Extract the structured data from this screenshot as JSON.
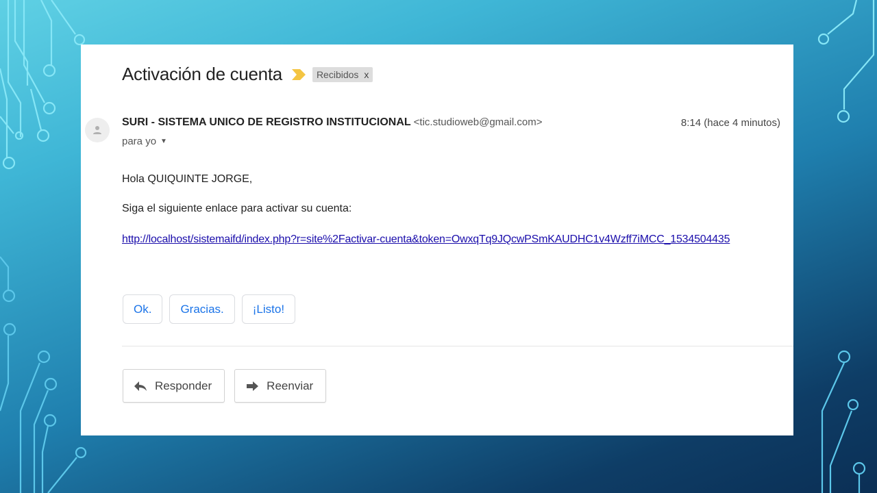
{
  "email": {
    "subject": "Activación de cuenta",
    "label": "Recibidos",
    "label_close": "x",
    "sender_name": "SURI - SISTEMA UNICO DE REGISTRO INSTITUCIONAL",
    "sender_email": "<tic.studioweb@gmail.com>",
    "time": "8:14 (hace 4 minutos)",
    "to": "para yo",
    "greeting": "Hola QUIQUINTE JORGE,",
    "instruction": "Siga el siguiente enlace para activar su cuenta:",
    "link": "http://localhost/sistemaifd/index.php?r=site%2Factivar-cuenta&token=OwxqTq9JQcwPSmKAUDHC1v4Wzff7iMCC_1534504435"
  },
  "smart_replies": [
    "Ok.",
    "Gracias.",
    "¡Listo!"
  ],
  "actions": {
    "reply": "Responder",
    "forward": "Reenviar"
  },
  "colors": {
    "link": "#1a0dab",
    "smart_reply": "#1a73e8",
    "important": "#f4c542",
    "circuit": "#7fe3f5"
  },
  "icons": [
    "important-marker-icon",
    "person-icon",
    "reply-arrow-icon",
    "forward-arrow-icon",
    "caret-down-icon"
  ]
}
